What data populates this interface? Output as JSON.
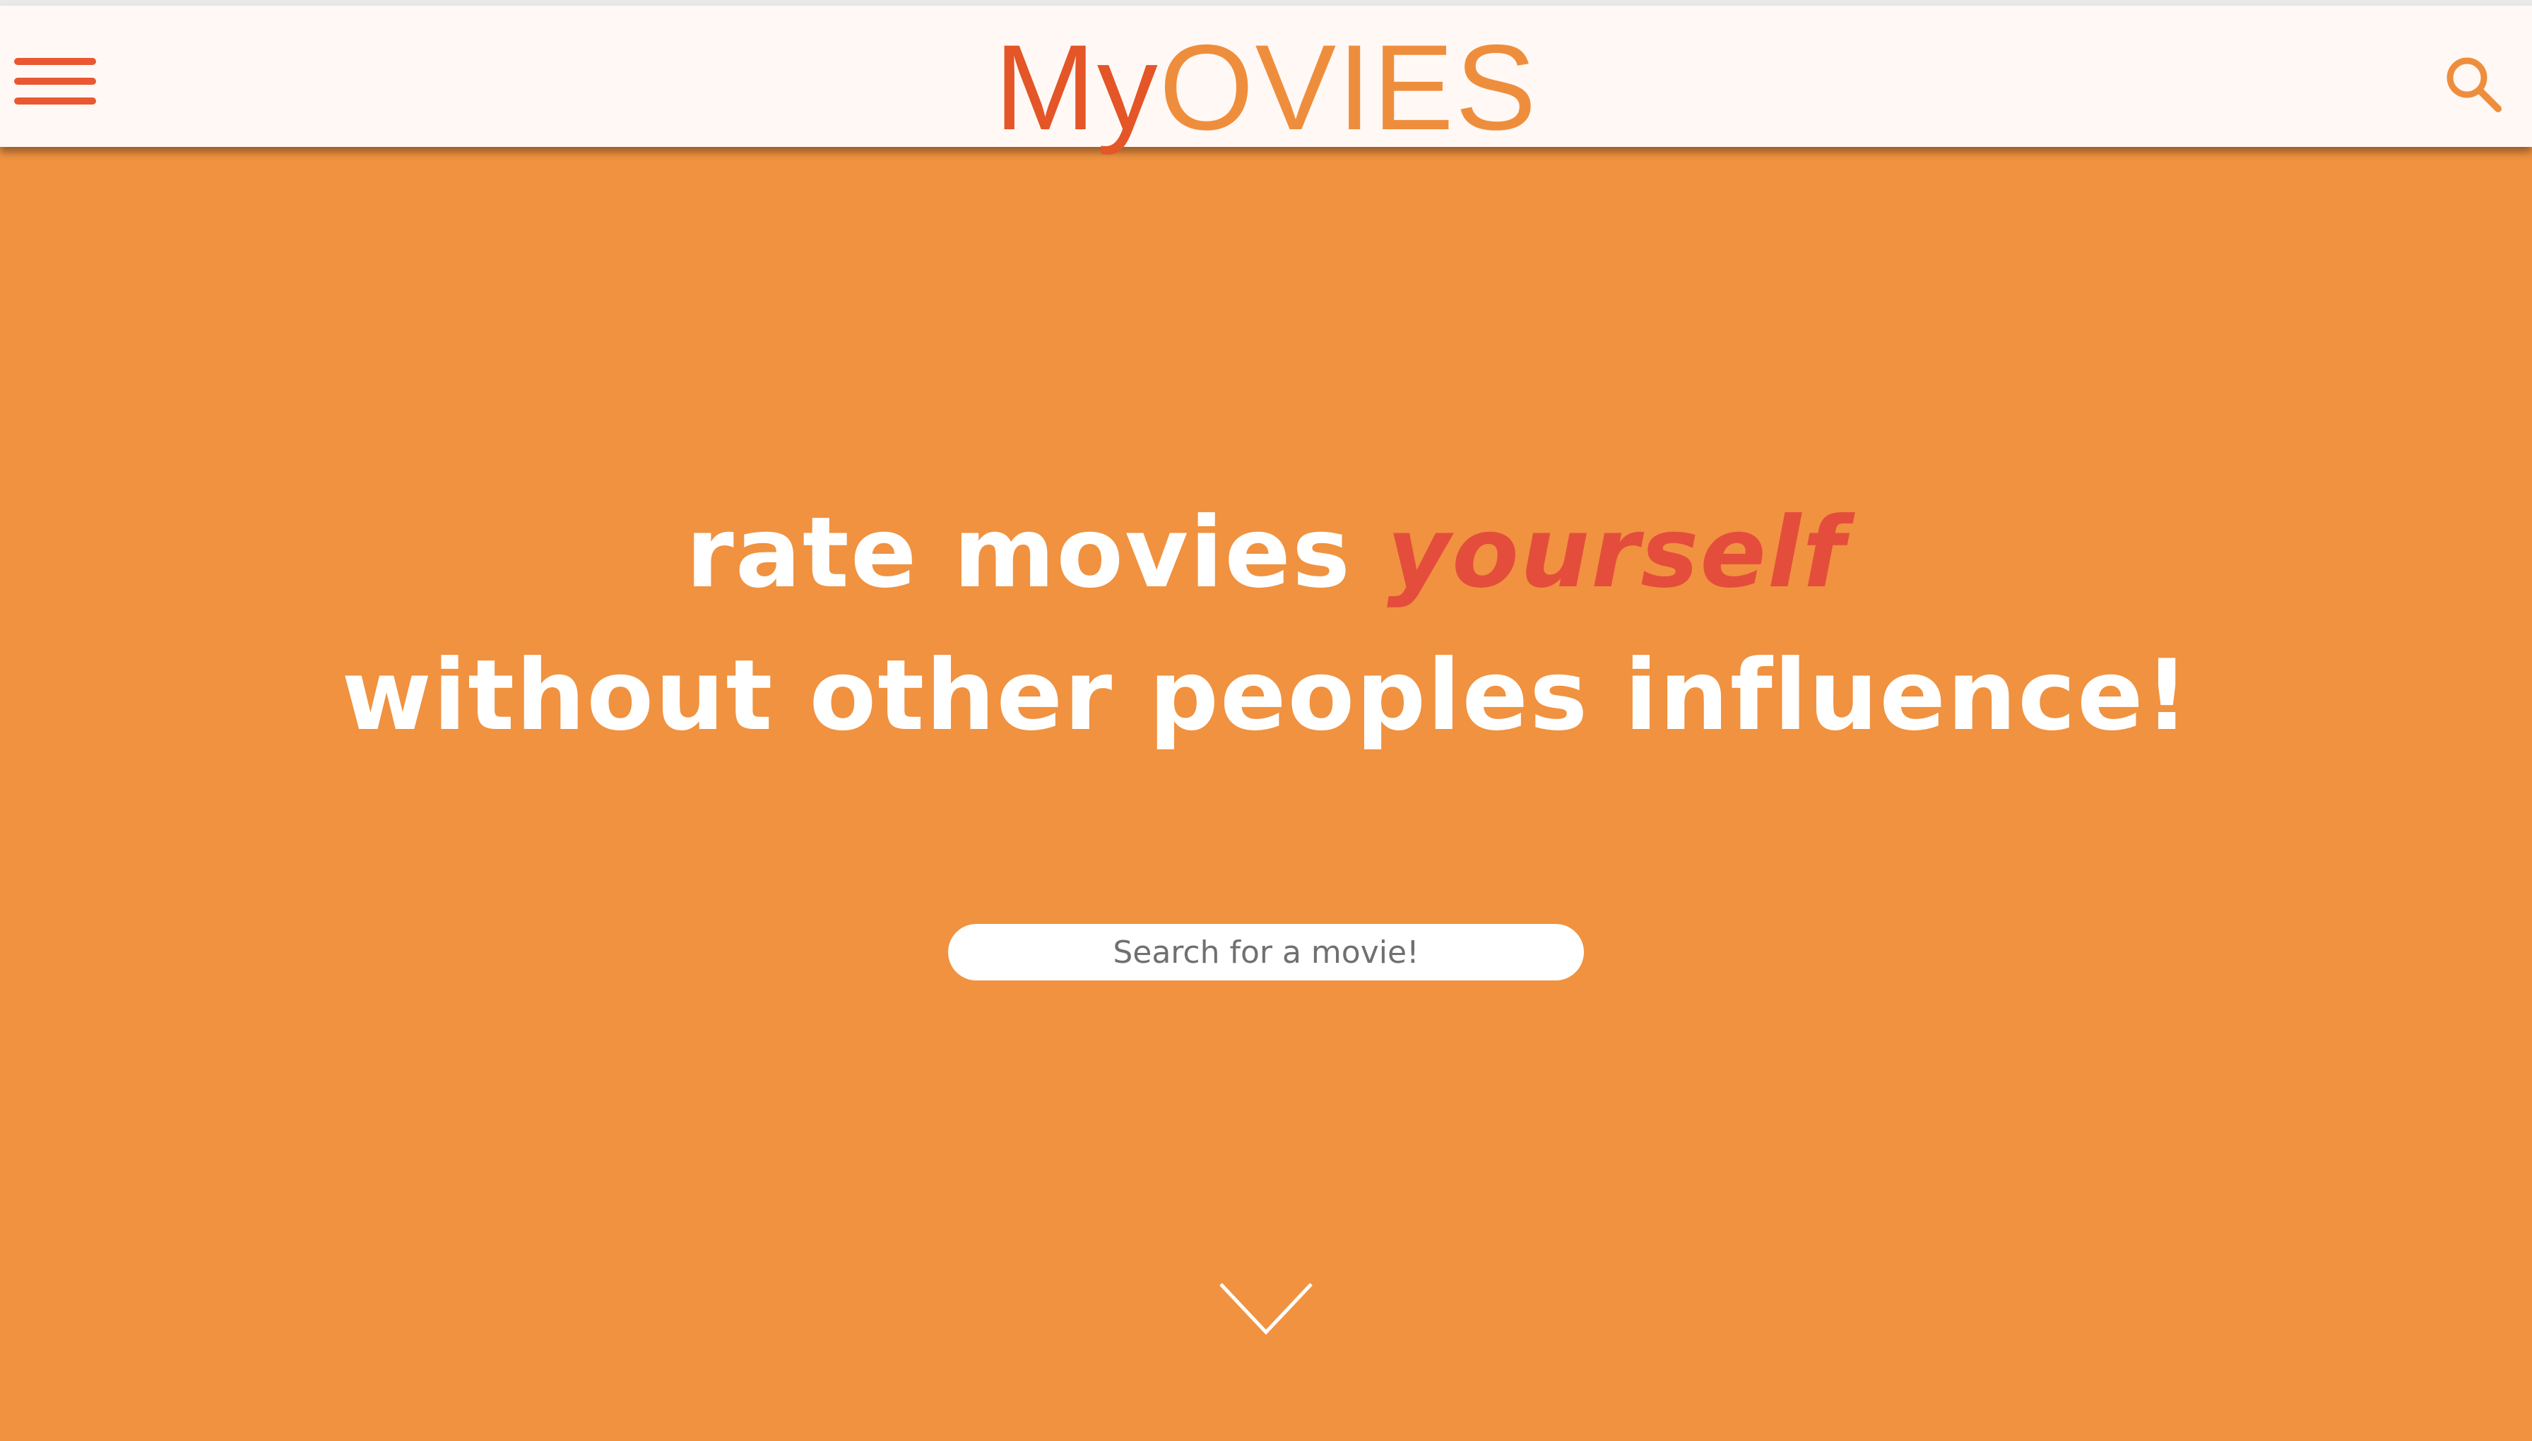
{
  "header": {
    "logo": {
      "part1": "My",
      "part2": "OVIES"
    },
    "menu_icon": "hamburger-menu-icon",
    "search_icon": "search-icon"
  },
  "hero": {
    "headline_line1": "rate movies ",
    "headline_accent": "yourself",
    "headline_line2": "without other peoples influence!",
    "search_placeholder": "Search for a movie!",
    "scroll_icon": "chevron-down-icon"
  },
  "colors": {
    "header_bg": "#fff8f5",
    "brand_red": "#e45527",
    "brand_orange": "#ee8e3d",
    "hero_bg": "#f09240",
    "accent_text": "#e44d3c",
    "headline_text": "#ffffff"
  }
}
